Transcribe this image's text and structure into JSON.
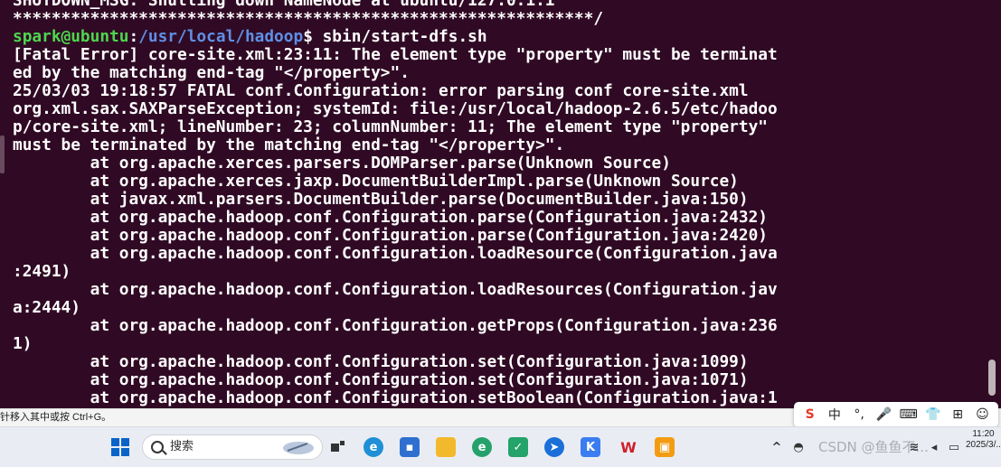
{
  "terminal": {
    "prompt_user": "spark@ubuntu",
    "prompt_sep": ":",
    "prompt_path": "/usr/local/hadoop",
    "prompt_command": "$ sbin/start-dfs.sh",
    "lines_before": [
      "SHUTDOWN_MSG: Shutting down NameNode at ubuntu/127.0.1.1",
      "************************************************************/"
    ],
    "lines_after": [
      "[Fatal Error] core-site.xml:23:11: The element type \"property\" must be terminat",
      "ed by the matching end-tag \"</property>\".",
      "25/03/03 19:18:57 FATAL conf.Configuration: error parsing conf core-site.xml",
      "org.xml.sax.SAXParseException; systemId: file:/usr/local/hadoop-2.6.5/etc/hadoo",
      "p/core-site.xml; lineNumber: 23; columnNumber: 11; The element type \"property\"",
      "must be terminated by the matching end-tag \"</property>\".",
      "        at org.apache.xerces.parsers.DOMParser.parse(Unknown Source)",
      "        at org.apache.xerces.jaxp.DocumentBuilderImpl.parse(Unknown Source)",
      "        at javax.xml.parsers.DocumentBuilder.parse(DocumentBuilder.java:150)",
      "        at org.apache.hadoop.conf.Configuration.parse(Configuration.java:2432)",
      "        at org.apache.hadoop.conf.Configuration.parse(Configuration.java:2420)",
      "        at org.apache.hadoop.conf.Configuration.loadResource(Configuration.java",
      ":2491)",
      "        at org.apache.hadoop.conf.Configuration.loadResources(Configuration.jav",
      "a:2444)",
      "        at org.apache.hadoop.conf.Configuration.getProps(Configuration.java:236",
      "1)",
      "        at org.apache.hadoop.conf.Configuration.set(Configuration.java:1099)",
      "        at org.apache.hadoop.conf.Configuration.set(Configuration.java:1071)",
      "        at org.apache.hadoop.conf.Configuration.setBoolean(Configuration.java:1"
    ]
  },
  "status_bar": {
    "text": "针移入其中或按 Ctrl+G。"
  },
  "ime": {
    "items": [
      {
        "name": "sogou-logo-icon",
        "glyph": "S"
      },
      {
        "name": "ime-mode-chinese",
        "glyph": "中"
      },
      {
        "name": "punctuation-icon",
        "glyph": "°,"
      },
      {
        "name": "microphone-icon",
        "glyph": "🎤"
      },
      {
        "name": "keyboard-icon",
        "glyph": "⌨"
      },
      {
        "name": "skin-icon",
        "glyph": "👕"
      },
      {
        "name": "grid-menu-icon",
        "glyph": "⊞"
      },
      {
        "name": "mascot-icon",
        "glyph": "☺"
      }
    ]
  },
  "taskbar": {
    "search_label": "搜索",
    "clock_time": "11:20",
    "clock_date": "2025/3/..",
    "watermark": "CSDN @鱼鱼不..."
  },
  "colors": {
    "terminal_bg": "#300a24",
    "prompt_user": "#4ed64e",
    "prompt_path": "#5f8fe6",
    "text": "#ffffff"
  }
}
